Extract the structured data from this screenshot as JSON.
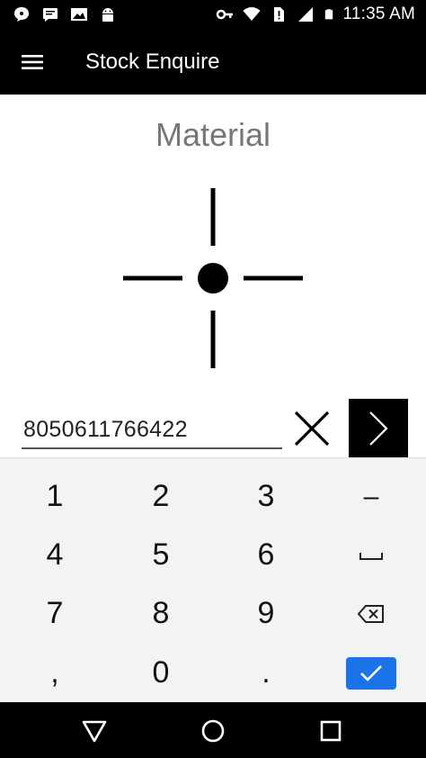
{
  "status_bar": {
    "time": "11:35 AM",
    "left_icons": [
      "chat-bubble-icon",
      "message-icon",
      "image-icon",
      "android-icon"
    ],
    "right_icons": [
      "key-icon",
      "wifi-icon",
      "no-sim-icon",
      "signal-icon",
      "battery-icon"
    ]
  },
  "app_bar": {
    "title": "Stock Enquire",
    "menu_icon": "hamburger-menu-icon"
  },
  "main": {
    "section_title": "Material",
    "scan_icon": "crosshair-icon",
    "code_input_value": "8050611766422",
    "clear_icon": "close-icon",
    "go_icon": "chevron-right-icon"
  },
  "keypad": {
    "keys": [
      "1",
      "2",
      "3",
      "–",
      "4",
      "5",
      "6",
      "␣",
      "7",
      "8",
      "9",
      "⌫",
      ",",
      "0",
      ".",
      "✓"
    ],
    "done_color": "#1a73e8"
  },
  "nav_bar": {
    "icons": [
      "back-triangle-icon",
      "home-circle-icon",
      "recents-square-icon"
    ]
  }
}
